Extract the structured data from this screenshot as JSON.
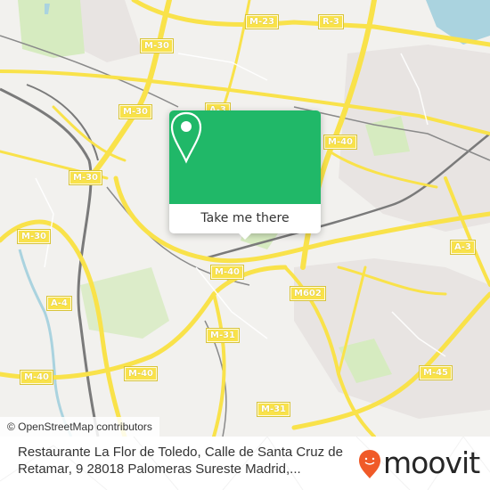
{
  "map": {
    "road_labels": [
      {
        "id": "m30-a",
        "text": "M-30"
      },
      {
        "id": "m23",
        "text": "M-23"
      },
      {
        "id": "r3",
        "text": "R-3"
      },
      {
        "id": "m30-b",
        "text": "M-30"
      },
      {
        "id": "a3-top",
        "text": "A-3"
      },
      {
        "id": "m40-ne",
        "text": "M-40"
      },
      {
        "id": "m30-c",
        "text": "M-30"
      },
      {
        "id": "m30-d",
        "text": "M-30"
      },
      {
        "id": "m40-center",
        "text": "M-40"
      },
      {
        "id": "a4",
        "text": "A-4"
      },
      {
        "id": "m602",
        "text": "M602"
      },
      {
        "id": "a3-east",
        "text": "A-3"
      },
      {
        "id": "m31-a",
        "text": "M-31"
      },
      {
        "id": "m40-sw",
        "text": "M-40"
      },
      {
        "id": "m40-s",
        "text": "M-40"
      },
      {
        "id": "m45",
        "text": "M-45"
      },
      {
        "id": "m31-b",
        "text": "M-31"
      }
    ],
    "attribution": "© OpenStreetMap contributors",
    "colors": {
      "road": "#f9e24a",
      "water": "#aad3df",
      "park": "#d6ebc0",
      "residential": "#e8e4e2",
      "rail": "#888888"
    }
  },
  "popup": {
    "icon": "map-pin-icon",
    "button_label": "Take me there",
    "accent_color": "#20b868"
  },
  "footer": {
    "address": "Restaurante La Flor de Toledo, Calle de Santa Cruz de Retamar, 9 28018 Palomeras Sureste Madrid,...",
    "brand": "moovit",
    "brand_color": "#f05a28"
  }
}
